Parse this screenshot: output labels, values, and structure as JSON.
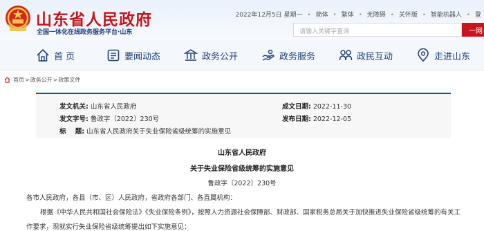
{
  "header": {
    "site_title": "山东省人民政府",
    "site_subtitle": "全国一体化在线政务服务平台·山东",
    "date_text": "2022年12月5日 星期一",
    "links": [
      "简体",
      "繁体",
      "无障碍",
      "关怀版",
      "智能机器人",
      "登"
    ],
    "search_placeholder": "请输入关键字查询",
    "search_button": "一网"
  },
  "nav": {
    "items": [
      {
        "label": "首 页",
        "icon": "home-icon"
      },
      {
        "label": "要闻动态",
        "icon": "news-icon"
      },
      {
        "label": "政务公开",
        "icon": "government-icon"
      },
      {
        "label": "政务服务",
        "icon": "service-icon"
      },
      {
        "label": "政民互动",
        "icon": "interaction-icon"
      },
      {
        "label": "走进山东",
        "icon": "location-icon"
      }
    ]
  },
  "breadcrumb": {
    "items": [
      "首页",
      "政务公开",
      "政策文件"
    ],
    "separator": ">"
  },
  "meta": {
    "issuer_label": "发文机关:",
    "issuer_value": "山东省人民政府",
    "doc_no_label": "发文字号:",
    "doc_no_value": "鲁政字〔2022〕230号",
    "title_label": "标    题:",
    "title_value": "山东省人民政府关于失业保险省级统筹的实施意见",
    "created_label": "成文日期:",
    "created_value": "2022-11-30",
    "published_label": "发布日期:",
    "published_value": "2022-12-05"
  },
  "article": {
    "org": "山东省人民政府",
    "title": "关于失业保险省级统筹的实施意见",
    "doc_no": "鲁政字〔2022〕230号",
    "recipients": "各市人民政府，各县（市、区）人民政府，省政府各部门、各直属机构：",
    "para1_line1": "根据《中华人民共和国社会保险法》《失业保险条例》，按照人力资源社会保障部、财政部、国家税务总局关于加快推进失业保险省级统筹的有关工",
    "para1_line2": "作要求，现就实行失业保险省级统筹提出如下实施意见："
  },
  "colors": {
    "brand_red": "#c4161c",
    "nav_blue": "#1f3f7a",
    "meta_border": "#1c4a95"
  }
}
